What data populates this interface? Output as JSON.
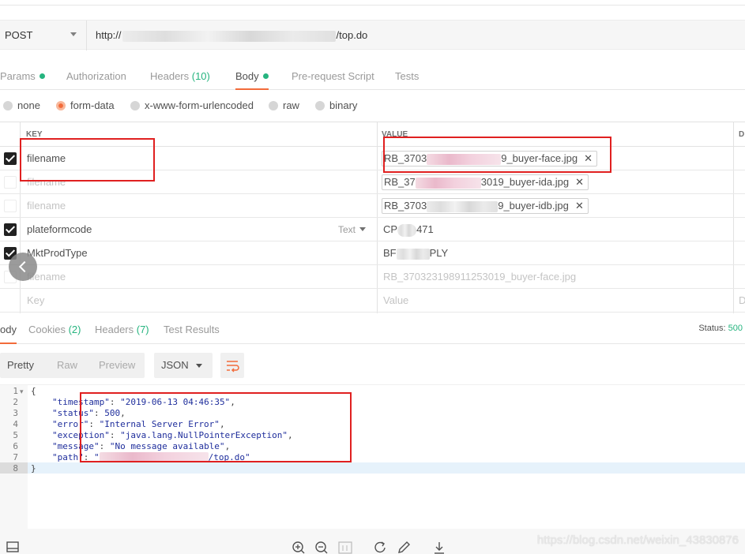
{
  "request": {
    "method": "POST",
    "url_prefix": "http://",
    "url_suffix": "/top.do"
  },
  "req_tabs": [
    {
      "label": "Params",
      "dot": true
    },
    {
      "label": "Authorization"
    },
    {
      "label": "Headers ",
      "count": "(10)"
    },
    {
      "label": "Body",
      "dot": true
    },
    {
      "label": "Pre-request Script"
    },
    {
      "label": "Tests"
    }
  ],
  "body_types": [
    "none",
    "form-data",
    "x-www-form-urlencoded",
    "raw",
    "binary"
  ],
  "table": {
    "key_header": "KEY",
    "value_header": "VALUE",
    "desc_header": "D",
    "rows": [
      {
        "key": "filename",
        "v_start": "RB_3703",
        "v_end": "9_buyer-face.jpg"
      },
      {
        "key": "filename",
        "v_start": "RB_37",
        "v_end": "3019_buyer-ida.jpg"
      },
      {
        "key": "filename",
        "v_start": "RB_3703",
        "v_end": "9_buyer-idb.jpg"
      },
      {
        "key": "plateformcode",
        "type": "Text",
        "v_start": "CP",
        "v_end": "471"
      },
      {
        "key": "MktProdType",
        "v_start": "BF",
        "v_end": "PLY"
      },
      {
        "key": "filename",
        "value": "RB_370323198911253019_buyer-face.jpg"
      },
      {
        "key": "Key",
        "value": "Value",
        "desc": "D"
      }
    ],
    "chip_close": "✕"
  },
  "resp_tabs": [
    {
      "label": "ody"
    },
    {
      "label": "Cookies ",
      "count": "(2)"
    },
    {
      "label": "Headers ",
      "count": "(7)"
    },
    {
      "label": "Test Results"
    }
  ],
  "status": {
    "label": "Status: ",
    "value": "500"
  },
  "view_buttons": [
    "Pretty",
    "Raw",
    "Preview"
  ],
  "format": "JSON",
  "code_lines": {
    "l1": "{",
    "timestamp_key": "\"timestamp\"",
    "timestamp_val": "\"2019-06-13 04:46:35\"",
    "status_key": "\"status\"",
    "status_val": "500",
    "error_key": "\"error\"",
    "error_val": "\"Internal Server Error\"",
    "exception_key": "\"exception\"",
    "exception_val": "\"java.lang.NullPointerException\"",
    "message_key": "\"message\"",
    "message_val": "\"No message available\"",
    "path_key": "\"path\"",
    "path_val_end": "/top.do\"",
    "l8": "}"
  },
  "line_numbers": [
    "1",
    "2",
    "3",
    "4",
    "5",
    "6",
    "7",
    "8"
  ],
  "watermark": "https://blog.csdn.net/weixin_43830876"
}
